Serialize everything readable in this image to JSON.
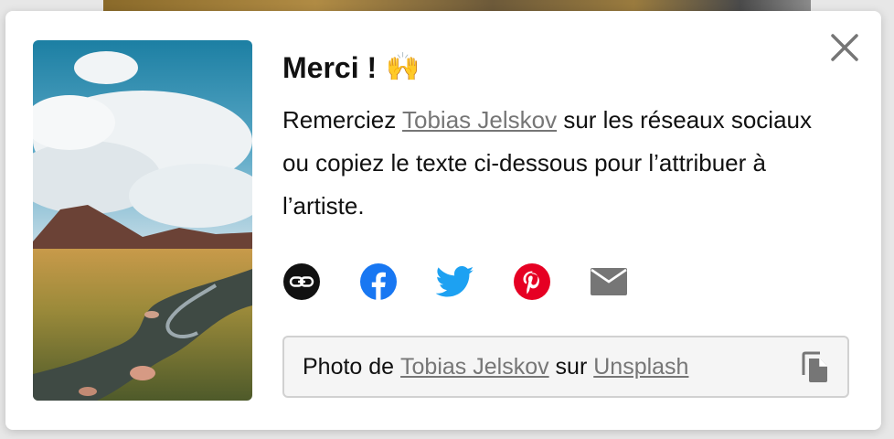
{
  "dialog": {
    "title": "Merci !",
    "title_emoji": "🙌",
    "description": {
      "before_link": "Remerciez ",
      "photographer_link": "Tobias Jelskov",
      "after_link": " sur les réseaux sociaux ou copiez le texte ci-dessous pour l’attribuer à l’artiste."
    },
    "share_icons": [
      "link-icon",
      "facebook-icon",
      "twitter-icon",
      "pinterest-icon",
      "email-icon"
    ],
    "attribution": {
      "prefix": "Photo de ",
      "photographer": "Tobias Jelskov",
      "middle": " sur ",
      "site": "Unsplash"
    }
  },
  "colors": {
    "facebook": "#1877f2",
    "twitter": "#1da1f2",
    "pinterest": "#e60023",
    "link_bg": "#111111",
    "email": "#767676",
    "link_text": "#767676"
  }
}
